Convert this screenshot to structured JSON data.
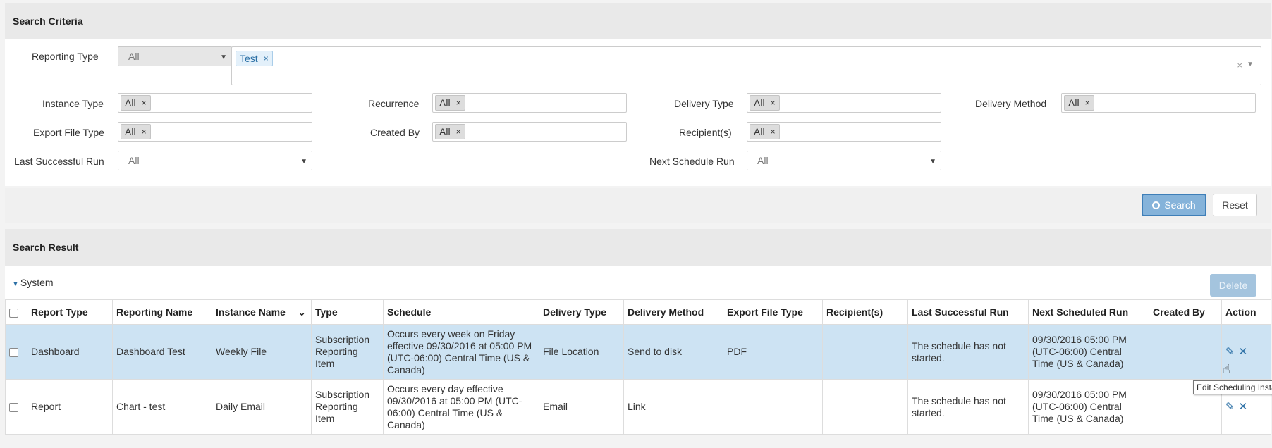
{
  "criteria": {
    "title": "Search Criteria",
    "reporting_type": {
      "label": "Reporting Type",
      "value": "All",
      "tags": [
        "Test"
      ]
    },
    "instance_type": {
      "label": "Instance Type",
      "tag": "All"
    },
    "recurrence": {
      "label": "Recurrence",
      "tag": "All"
    },
    "delivery_type": {
      "label": "Delivery Type",
      "tag": "All"
    },
    "delivery_method": {
      "label": "Delivery Method",
      "tag": "All"
    },
    "export_file_type": {
      "label": "Export File Type",
      "tag": "All"
    },
    "created_by": {
      "label": "Created By",
      "tag": "All"
    },
    "recipients": {
      "label": "Recipient(s)",
      "tag": "All"
    },
    "last_successful_run": {
      "label": "Last Successful Run",
      "value": "All"
    },
    "next_schedule_run": {
      "label": "Next Schedule Run",
      "value": "All"
    },
    "search_label": "Search",
    "reset_label": "Reset"
  },
  "results": {
    "title": "Search Result",
    "group": "System",
    "delete_label": "Delete",
    "columns": [
      "Report Type",
      "Reporting Name",
      "Instance Name",
      "Type",
      "Schedule",
      "Delivery Type",
      "Delivery Method",
      "Export File Type",
      "Recipient(s)",
      "Last Successful Run",
      "Next Scheduled Run",
      "Created By",
      "Action"
    ],
    "rows": [
      {
        "report_type": "Dashboard",
        "reporting_name": "Dashboard Test",
        "instance_name": "Weekly File",
        "type": "Subscription Reporting Item",
        "schedule": "Occurs every week on Friday effective 09/30/2016 at 05:00 PM (UTC-06:00) Central Time (US & Canada)",
        "delivery_type": "File Location",
        "delivery_method": "Send to disk",
        "export_file_type": "PDF",
        "recipients": "",
        "last_successful_run": "The schedule has not started.",
        "next_scheduled_run": "09/30/2016 05:00 PM (UTC-06:00) Central Time (US & Canada)",
        "created_by": ""
      },
      {
        "report_type": "Report",
        "reporting_name": "Chart - test",
        "instance_name": "Daily Email",
        "type": "Subscription Reporting Item",
        "schedule": "Occurs every day effective 09/30/2016 at 05:00 PM (UTC-06:00) Central Time (US & Canada)",
        "delivery_type": "Email",
        "delivery_method": "Link",
        "export_file_type": "",
        "recipients": "",
        "last_successful_run": "The schedule has not started.",
        "next_scheduled_run": "09/30/2016 05:00 PM (UTC-06:00) Central Time (US & Canada)",
        "created_by": ""
      }
    ],
    "tooltip": "Edit Scheduling Insta"
  }
}
